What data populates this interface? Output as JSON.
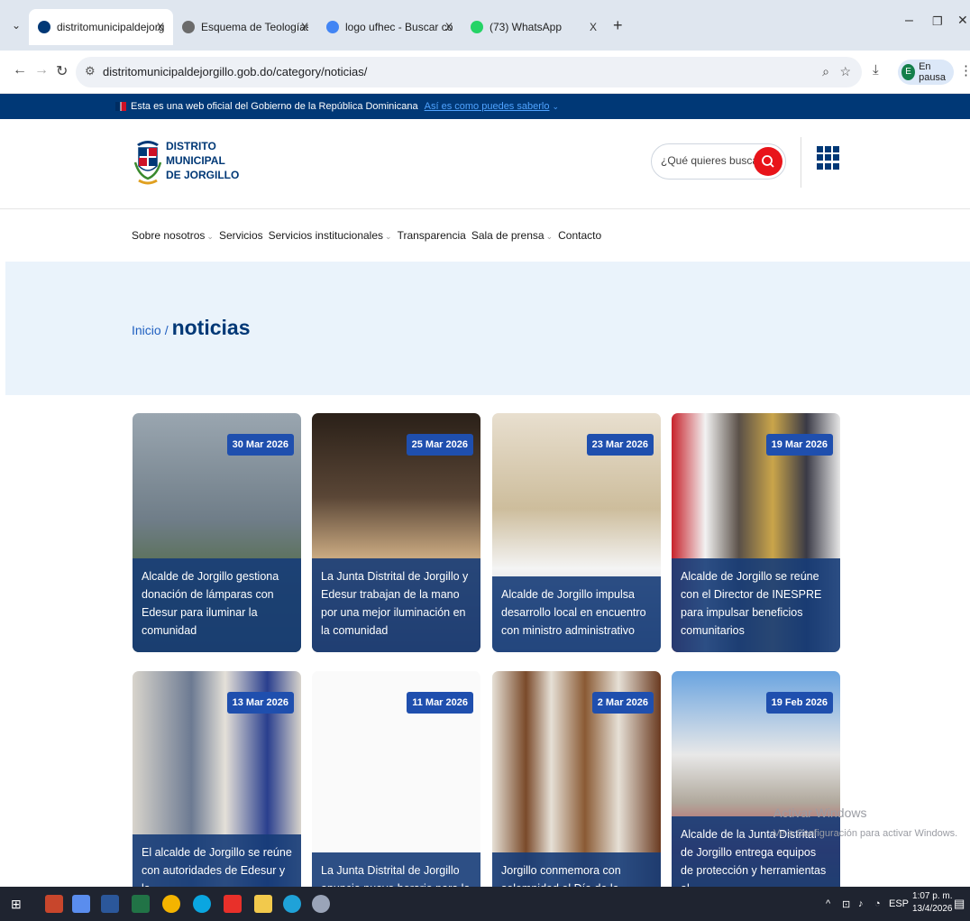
{
  "browser": {
    "tabs": [
      {
        "title": "distritomunicipaldejorgillo.gob.",
        "active": true,
        "favicon_color": "#003876"
      },
      {
        "title": "Esquema de Teologías",
        "active": false,
        "favicon_color": "#6b6b6b"
      },
      {
        "title": "logo ufhec - Buscar con Google",
        "active": false,
        "favicon_color": "#4285f4"
      },
      {
        "title": "(73) WhatsApp",
        "active": false,
        "favicon_color": "#25d366"
      }
    ],
    "tab_close": "X",
    "new_tab": "+",
    "url": "distritomunicipaldejorgillo.gob.do/category/noticias/",
    "profile_initial": "E",
    "profile_label": "En pausa"
  },
  "gov_banner": {
    "text": "Esta es una web oficial del Gobierno de la República Dominicana",
    "link": "Así es como puedes saberlo"
  },
  "header": {
    "logo_lines": [
      "DISTRITO",
      "MUNICIPAL",
      "DE JORGILLO"
    ],
    "search_placeholder": "¿Qué quieres buscar?"
  },
  "nav": {
    "items": [
      {
        "label": "Sobre nosotros",
        "dropdown": true
      },
      {
        "label": "Servicios",
        "dropdown": false
      },
      {
        "label": "Servicios institucionales",
        "dropdown": true
      },
      {
        "label": "Transparencia",
        "dropdown": false
      },
      {
        "label": "Sala de prensa",
        "dropdown": true
      },
      {
        "label": "Contacto",
        "dropdown": false
      }
    ]
  },
  "breadcrumb": {
    "home": "Inicio",
    "separator": "/",
    "current": "noticias"
  },
  "cards": [
    {
      "date": "30 Mar 2026",
      "title": "Alcalde de Jorgillo gestiona donación de lámparas con Edesur para iluminar la comunidad"
    },
    {
      "date": "25 Mar 2026",
      "title": "La Junta Distrital de Jorgillo y Edesur trabajan de la mano por una mejor iluminación en la comunidad"
    },
    {
      "date": "23 Mar 2026",
      "title": "Alcalde de Jorgillo impulsa desarrollo local en encuentro con ministro administrativo"
    },
    {
      "date": "19 Mar 2026",
      "title": "Alcalde de Jorgillo se reúne con el Director de INESPRE para impulsar beneficios comunitarios"
    },
    {
      "date": "13 Mar 2026",
      "title": "El alcalde de Jorgillo se reúne con autoridades de Edesur y la"
    },
    {
      "date": "11 Mar 2026",
      "title": "La Junta Distrital de Jorgillo anuncia nuevo horario para la"
    },
    {
      "date": "2 Mar 2026",
      "title": "Jorgillo conmemora con solemnidad el Día de la"
    },
    {
      "date": "19 Feb 2026",
      "title": "Alcalde de la Junta Distrital de Jorgillo entrega equipos de protección y herramientas al"
    }
  ],
  "watermark": {
    "line1": "Activar Windows",
    "line2": "Ve a Configuración para activar Windows."
  },
  "taskbar": {
    "tray_lang": "ESP",
    "time": "1:07 p. m.",
    "date": "13/4/2026"
  }
}
